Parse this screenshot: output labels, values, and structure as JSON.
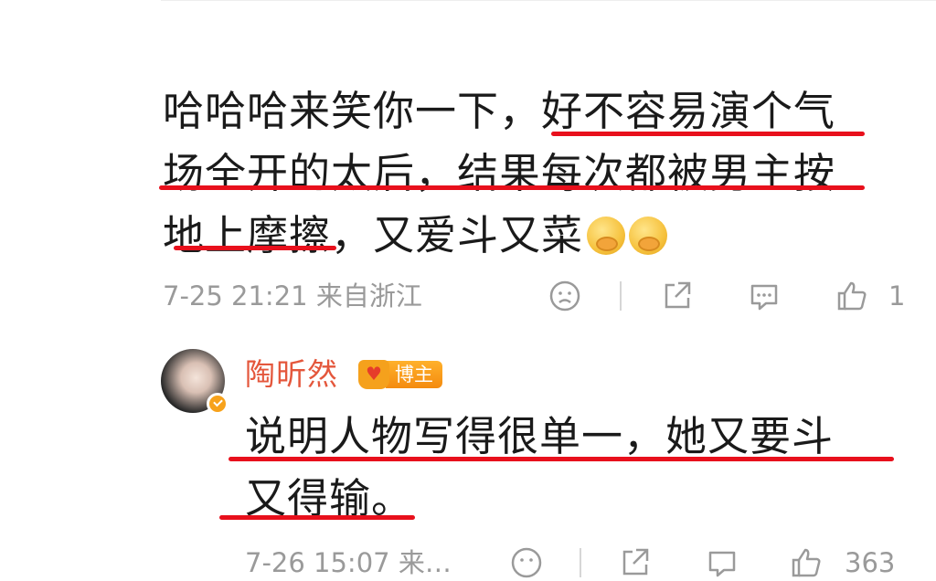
{
  "comment": {
    "lines": [
      "哈哈哈来笑你一下，好不容易演个气",
      "场全开的太后，结果每次都被男主按",
      "地上摩擦，又爱斗又菜"
    ],
    "emoji": [
      "cover-mouth-laugh-emoji",
      "cover-mouth-laugh-emoji"
    ],
    "meta": "7-25 21:21 来自浙江",
    "like_count": "1"
  },
  "reply": {
    "username": "陶昕然",
    "badge": "博主",
    "lines": [
      "说明人物写得很单一，她又要斗",
      "又得输。"
    ],
    "meta": "7-26 15:07 来…",
    "like_count": "363"
  },
  "icons": [
    "sad-face-icon",
    "share-icon",
    "comment-icon",
    "thumbs-up-icon"
  ],
  "colors": {
    "underline": "#e8101c",
    "username": "#e4573c",
    "meta_gray": "#9a9a9a",
    "badge_orange": "#f5a11c"
  }
}
